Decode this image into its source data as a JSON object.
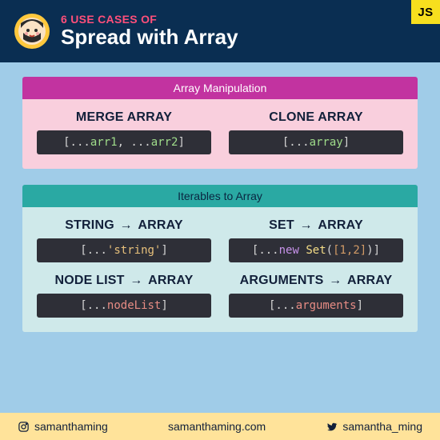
{
  "header": {
    "subtitle": "6 USE CASES OF",
    "title": "Spread with Array",
    "badge": "JS"
  },
  "sections": [
    {
      "heading": "Array Manipulation",
      "rows": [
        [
          {
            "title": "MERGE ARRAY",
            "code": {
              "pre": "[",
              "spread": "...",
              "v1": "arr1",
              "mid": ", ",
              "spread2": "...",
              "v2": "arr2",
              "post": "]"
            }
          },
          {
            "title": "CLONE ARRAY",
            "code": {
              "pre": "[",
              "spread": "...",
              "v1": "array",
              "post": "]"
            }
          }
        ]
      ]
    },
    {
      "heading": "Iterables to Array",
      "rows": [
        [
          {
            "title_l": "STRING",
            "title_r": "ARRAY",
            "code": {
              "pre": "[",
              "spread": "...",
              "str": "'string'",
              "post": "]"
            }
          },
          {
            "title_l": "SET",
            "title_r": "ARRAY",
            "code": {
              "pre": "[",
              "spread": "...",
              "kw": "new ",
              "cls": "Set",
              "open": "(",
              "arr": "[1,2]",
              "close": ")",
              "post": "]"
            }
          }
        ],
        [
          {
            "title_l": "NODE LIST",
            "title_r": "ARRAY",
            "code": {
              "pre": "[",
              "spread": "...",
              "vr": "nodeList",
              "post": "]"
            }
          },
          {
            "title_l": "ARGUMENTS",
            "title_r": "ARRAY",
            "code": {
              "pre": "[",
              "spread": "...",
              "vr": "arguments",
              "post": "]"
            }
          }
        ]
      ]
    }
  ],
  "footer": {
    "instagram": "samanthaming",
    "site": "samanthaming.com",
    "twitter": "samantha_ming"
  }
}
